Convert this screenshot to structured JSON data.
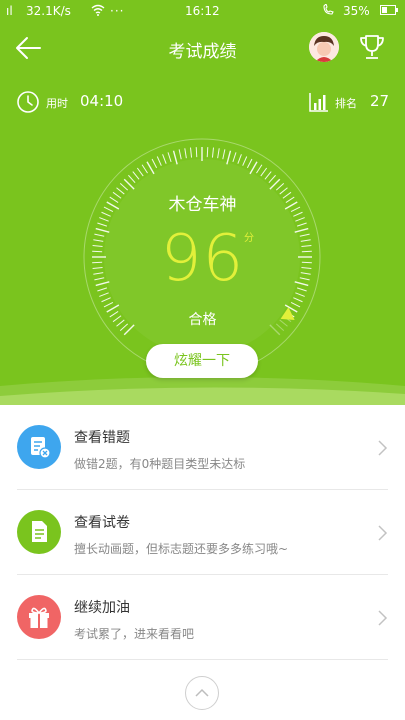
{
  "status_bar": {
    "signal": "ıl",
    "network_speed": "32.1K/s",
    "clock": "16:12",
    "battery": "35%"
  },
  "header": {
    "title": "考试成绩"
  },
  "stats": {
    "time_label": "用时",
    "time_value": "04:10",
    "rank_label": "排名",
    "rank_value": "27"
  },
  "result": {
    "nickname": "木仓车神",
    "score": "96",
    "score_unit": "分",
    "verdict": "合格",
    "score_fraction": 0.96
  },
  "share_button": {
    "label": "炫耀一下"
  },
  "menu": [
    {
      "title": "查看错题",
      "subtitle": "做错2题，有0种题目类型未达标",
      "icon": "mistakes-icon",
      "color": "#3ea6ee"
    },
    {
      "title": "查看试卷",
      "subtitle": "擅长动画题，但标志题还要多多练习哦~",
      "icon": "paper-icon",
      "color": "#7ac41e"
    },
    {
      "title": "继续加油",
      "subtitle": "考试累了，进来看看吧",
      "icon": "gift-icon",
      "color": "#f06565"
    }
  ],
  "colors": {
    "primary_green": "#7ac41e",
    "score_yellow": "#e2f03a"
  }
}
